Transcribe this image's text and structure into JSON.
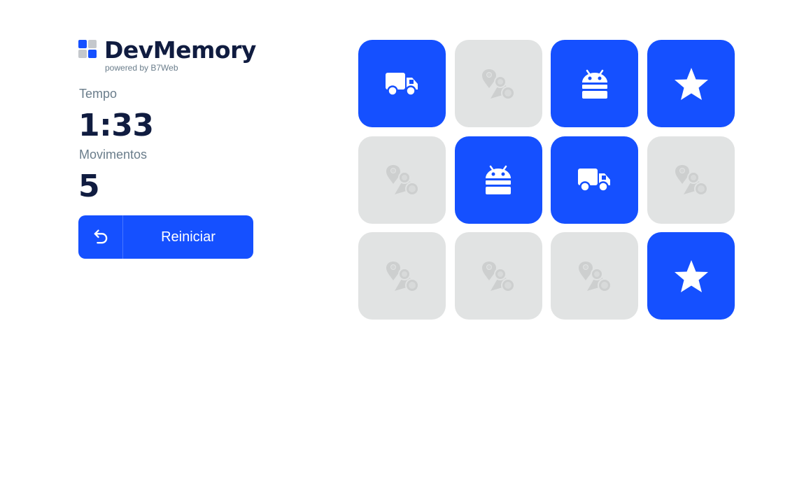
{
  "brand": {
    "title": "DevMemory",
    "subtitle": "powered by B7Web",
    "logo_icon": "four-squares-logo-icon"
  },
  "stats": {
    "time_label": "Tempo",
    "time_value": "1:33",
    "moves_label": "Movimentos",
    "moves_value": "5"
  },
  "restart": {
    "icon": "undo-arrow-icon",
    "label": "Reiniciar"
  },
  "colors": {
    "accent": "#1550ff",
    "card_hidden": "#e1e3e3",
    "card_hidden_icon": "#cdcfcf",
    "text_dark": "#101c40",
    "text_muted": "#6a7d8b",
    "logo_gray": "#c5c8cc"
  },
  "board": {
    "columns": 4,
    "rows": 3,
    "cards": [
      {
        "state": "revealed",
        "icon": "truck-icon"
      },
      {
        "state": "hidden",
        "icon": "map-pins-icon"
      },
      {
        "state": "revealed",
        "icon": "android-icon"
      },
      {
        "state": "revealed",
        "icon": "star-icon"
      },
      {
        "state": "hidden",
        "icon": "map-pins-icon"
      },
      {
        "state": "revealed",
        "icon": "android-icon"
      },
      {
        "state": "revealed",
        "icon": "truck-icon"
      },
      {
        "state": "hidden",
        "icon": "map-pins-icon"
      },
      {
        "state": "hidden",
        "icon": "map-pins-icon"
      },
      {
        "state": "hidden",
        "icon": "map-pins-icon"
      },
      {
        "state": "hidden",
        "icon": "map-pins-icon"
      },
      {
        "state": "revealed",
        "icon": "star-icon"
      }
    ]
  }
}
